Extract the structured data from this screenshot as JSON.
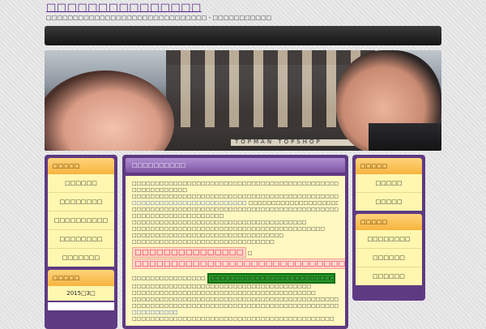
{
  "header": {
    "site_title": "□□□□□□□□□□□□□□□",
    "site_description": "□□□□□□□□□□□□□□□□□□□□□□□□□□□□□□ - □□□□□□□□□□□"
  },
  "banner": {
    "sign_text": "TOPMAN TOPSHOP"
  },
  "sidebar_left": {
    "widget1": {
      "title": "□□□□□",
      "items": [
        "□□□□□□",
        "□□□□□□□□",
        "□□□□□□□□□□",
        "□□□□□□□□",
        "□□□□□□□"
      ]
    },
    "widget2": {
      "title": "□□□□□",
      "items": [
        "2015□3□"
      ]
    }
  },
  "sidebar_right": {
    "widget1": {
      "title": "□□□□□",
      "items": [
        "□□□□□",
        "□□□□□"
      ]
    },
    "widget2": {
      "title": "□□□□□",
      "items": [
        "□□□□□□□□",
        "□□□□□□",
        "□□□□□□"
      ]
    }
  },
  "main": {
    "title": "□□□□□□□□□□",
    "lines": [
      "□□□□□□□□□□□□□□□□□□□□□□□□□□□□□□□□□□□□□□□□□□□□□□□□□□□□□□□□□□□□□",
      "□□□□□□□□□□□□",
      "□□□□□□□□□□□□□□□□□□□□□□□□□□□□□□□□□□□□□□□□□□□□□□□□□",
      "□□□□□□□□□□□□□□□□□□□□□□□□□□□□□□□□□□□□□□□□□□□□□□□□",
      "□□□□□□□□□□□□□□□□□□□□",
      "□□□□□□□□□□□□□□□□□□□□□□□□□□□□□□□□□□□□□□",
      "□□□□□□□□□□□□□□□□□□□□□□□□□□□□□□□□□□□□□□□□□□",
      "□□□□□□□□□□□□□□□□□□□□□□□□□□□□□□□□□",
      "□□□□□□□□□□□□□□□□□□□□□□□□□□□□□□□"
    ],
    "link_text": "□□□□□□□□□□□□□□□□□□□□□□□□□",
    "link_tail": "□□□□□□□□□□□□□□□□□□□□□□□□□",
    "big_red_1": "□□□□□□□□□□□□□□□",
    "big_red_sep": "□",
    "big_red_2": "□□□□□□□□□□□□□□□□□□□□□□□□□□□□□",
    "pre_green": "□□□□□□□□□□□□□□□□",
    "green_text": "□□□□□□□□□□□□□□□□□□□□□□□□□□□□□□□□□□□□□□",
    "lines_after": [
      "□□□□□□□□□□□□□□□□□□□□□□□□□□□□□□□□□□□□□□□",
      "□□□□□□□□□□□□□□□□□□□□□□□□□□□□□□□□□□□□□□□□",
      "□□□□□□□□□□□□□□□□□□□□□□□□□□□□□□□□□□□□□□□□□□□□□□□□",
      "□□□□□□□□□□□□□□□□□□□□□□□□□□□□□□□□□□□□□□□□□□□□□□□□□□□□",
      "□□□□□□□□□□□□□□□□□□□□□□□□□□□□□□□□□□□□□□□□□□□□"
    ],
    "link2": "□□□□□□□□□□"
  }
}
